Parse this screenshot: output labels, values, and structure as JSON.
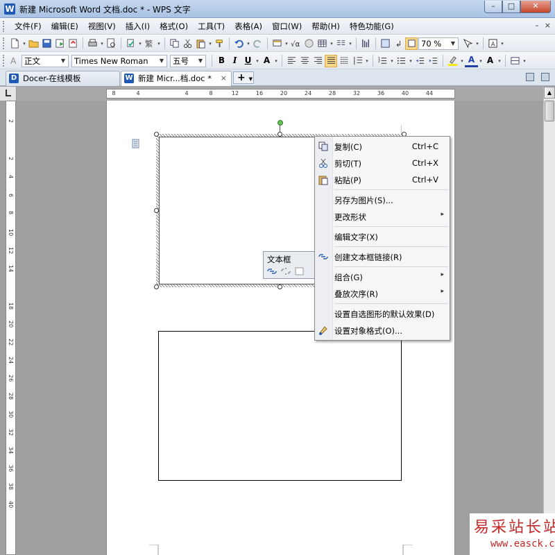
{
  "titlebar": {
    "logo": "W",
    "title": "新建 Microsoft Word 文档.doc * - WPS 文字",
    "min": "–",
    "restore": "□",
    "close": "✕"
  },
  "menubar": {
    "items": [
      "文件(F)",
      "编辑(E)",
      "视图(V)",
      "插入(I)",
      "格式(O)",
      "工具(T)",
      "表格(A)",
      "窗口(W)",
      "帮助(H)",
      "特色功能(G)"
    ],
    "right_min": "–",
    "right_close": "×"
  },
  "toolbar1": {
    "zoom": "70 %"
  },
  "toolbar2": {
    "style": "正文",
    "font": "Times New Roman",
    "size": "五号",
    "bold": "B",
    "italic": "I",
    "underline": "U",
    "char_a": "A",
    "font_color": "A",
    "grow_font": "A"
  },
  "tabs": {
    "docer_icon": "D",
    "docer": "Docer-在线模板",
    "doc_icon": "W",
    "doc": "新建 Micr...档.doc *",
    "close": "×",
    "add": "+"
  },
  "ruler": {
    "labels": [
      "8",
      "4",
      "4",
      "8",
      "12",
      "16",
      "20",
      "24",
      "28",
      "32",
      "36",
      "40",
      "44"
    ],
    "vlabels": [
      "2",
      "2",
      "4",
      "6",
      "8",
      "10",
      "12",
      "14",
      "18",
      "20",
      "22",
      "24",
      "26",
      "28",
      "30",
      "32",
      "34",
      "36",
      "38",
      "40"
    ]
  },
  "textbox_toolbar": {
    "title": "文本框"
  },
  "context_menu": {
    "items": [
      {
        "label": "复制(C)",
        "shortcut": "Ctrl+C",
        "icon": "copy-icon"
      },
      {
        "label": "剪切(T)",
        "shortcut": "Ctrl+X",
        "icon": "cut-icon"
      },
      {
        "label": "粘贴(P)",
        "shortcut": "Ctrl+V",
        "icon": "paste-icon"
      },
      {
        "label": "另存为图片(S)..."
      },
      {
        "label": "更改形状",
        "submenu": "▸"
      },
      {
        "label": "编辑文字(X)"
      },
      {
        "label": "创建文本框链接(R)",
        "icon": "link-icon"
      },
      {
        "label": "组合(G)",
        "submenu": "▸"
      },
      {
        "label": "叠放次序(R)",
        "submenu": "▸"
      },
      {
        "label": "设置自选图形的默认效果(D)"
      },
      {
        "label": "设置对象格式(O)...",
        "icon": "format-object-icon"
      }
    ]
  },
  "watermark": {
    "cn": "易采站长站",
    "url": "www.easck.com"
  },
  "colors": {
    "accent": "#1e5ab4",
    "page": "#ffffff",
    "workspace": "#a0a0a0"
  }
}
